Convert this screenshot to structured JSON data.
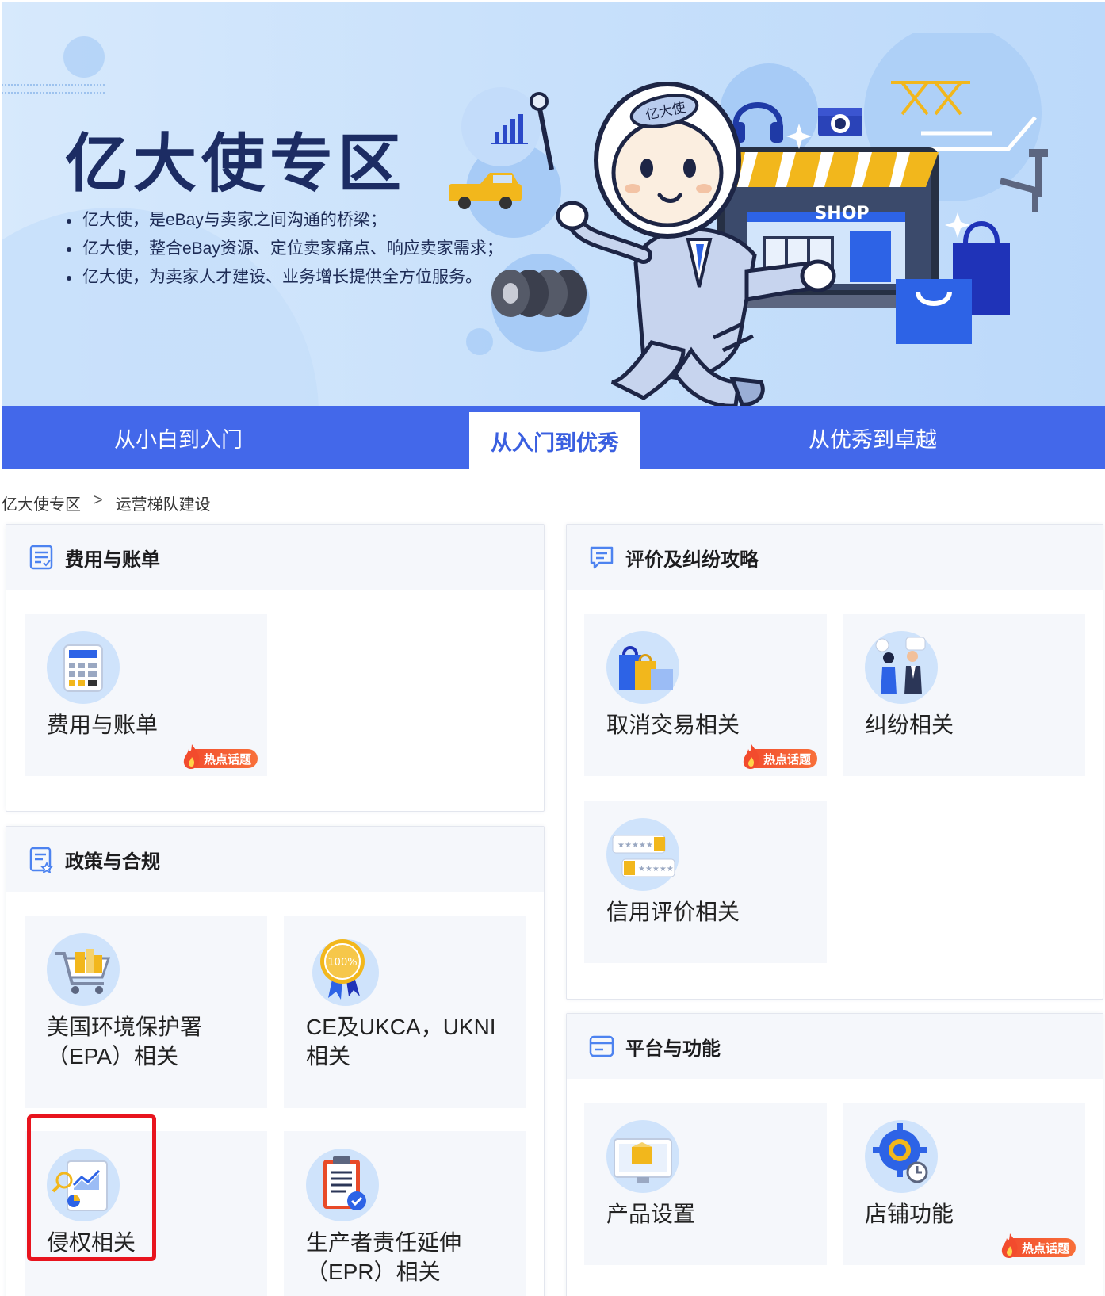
{
  "banner": {
    "title": "亿大使专区",
    "bullets": [
      "亿大使，是eBay与卖家之间沟通的桥梁；",
      "亿大使，整合eBay资源、定位卖家痛点、响应卖家需求；",
      "亿大使，为卖家人才建设、业务增长提供全方位服务。"
    ],
    "mascot_badge": "亿大使",
    "shop_sign": "SHOP"
  },
  "tabs": [
    {
      "label": "从小白到入门",
      "active": false
    },
    {
      "label": "从入门到优秀",
      "active": true
    },
    {
      "label": "从优秀到卓越",
      "active": false
    }
  ],
  "breadcrumb": {
    "root": "亿大使专区",
    "separator": ">",
    "current": "运营梯队建设"
  },
  "hot_label": "热点话题",
  "panels": {
    "billing": {
      "title": "费用与账单",
      "icon": "bill-icon",
      "cards": [
        {
          "label": "费用与账单",
          "icon": "calculator-icon",
          "hot": true
        }
      ]
    },
    "policy": {
      "title": "政策与合规",
      "icon": "policy-doc-icon",
      "cards": [
        {
          "label": "美国环境保护署（EPA）相关",
          "icon": "shopping-cart-icon",
          "hot": false
        },
        {
          "label": "CE及UKCA，UKNI相关",
          "icon": "certificate-badge-icon",
          "hot": false,
          "badge_text": "100%"
        },
        {
          "label": "侵权相关",
          "icon": "report-chart-icon",
          "hot": false
        },
        {
          "label": "生产者责任延伸（EPR）相关",
          "icon": "clipboard-check-icon",
          "hot": false
        }
      ]
    },
    "disputes": {
      "title": "评价及纠纷攻略",
      "icon": "message-icon",
      "cards": [
        {
          "label": "取消交易相关",
          "icon": "shopping-bags-icon",
          "hot": true
        },
        {
          "label": "纠纷相关",
          "icon": "people-talk-icon",
          "hot": false
        },
        {
          "label": "信用评价相关",
          "icon": "rating-cards-icon",
          "hot": false
        }
      ]
    },
    "platform": {
      "title": "平台与功能",
      "icon": "window-icon",
      "cards": [
        {
          "label": "产品设置",
          "icon": "product-box-icon",
          "hot": false
        },
        {
          "label": "店铺功能",
          "icon": "gear-clock-icon",
          "hot": true
        }
      ]
    }
  },
  "colors": {
    "brand_blue": "#4368ea",
    "navy": "#1c2c63",
    "hot_red": "#f24b2d",
    "highlight_red": "#e8141e"
  }
}
